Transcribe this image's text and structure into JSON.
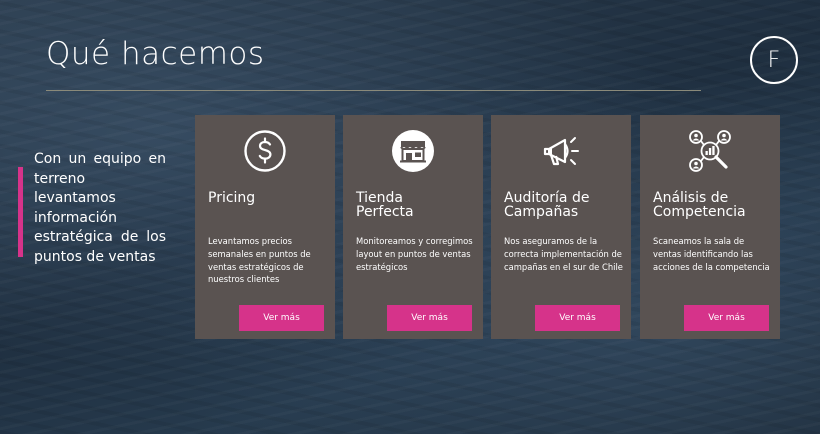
{
  "title": "Qué hacemos",
  "logo_letter": "F",
  "intro": "Con un equipo en terreno levantamos información estratégica de los puntos de ventas",
  "accent_color": "#d6338a",
  "card_color": "#5a5351",
  "cards": [
    {
      "icon": "dollar-coin-icon",
      "title": "Pricing",
      "description": "Levantamos precios semanales en puntos de ventas estratégicos de nuestros clientes",
      "button": "Ver más"
    },
    {
      "icon": "storefront-icon",
      "title": "Tienda\nPerfecta",
      "description": "Monitoreamos  y corregimos  layout en puntos de ventas estratégicos",
      "button": "Ver más"
    },
    {
      "icon": "megaphone-icon",
      "title": "Auditoría de Campañas",
      "description": "Nos aseguramos de la correcta implementación de campañas en el sur de Chile",
      "button": "Ver más"
    },
    {
      "icon": "people-analysis-icon",
      "title": "Análisis de Competencia",
      "description": "Scaneamos la sala de ventas identificando las acciones de la competencia",
      "button": "Ver más"
    }
  ]
}
